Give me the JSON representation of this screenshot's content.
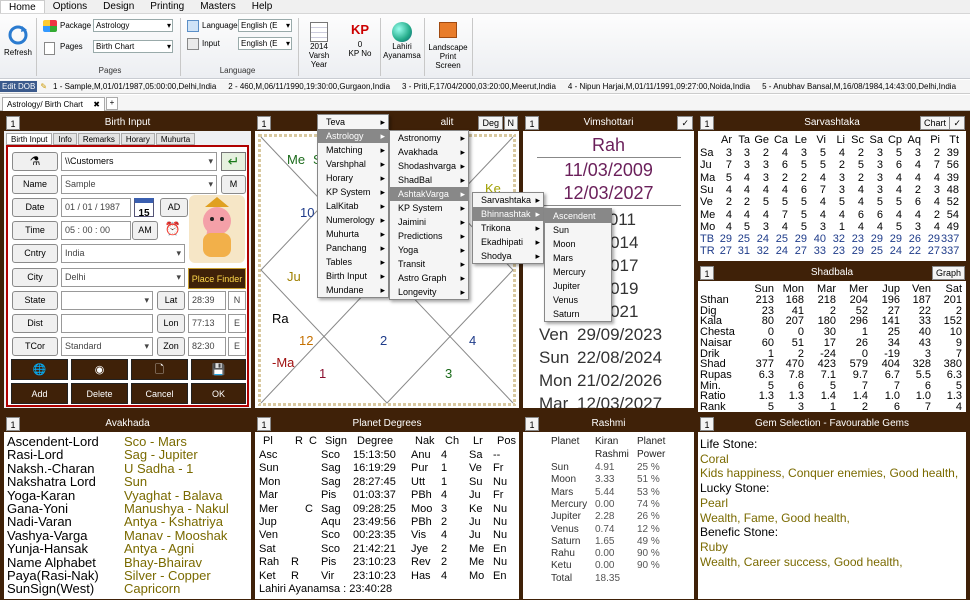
{
  "menubar": [
    "Home",
    "Options",
    "Design",
    "Printing",
    "Masters",
    "Help"
  ],
  "ribbon": {
    "refresh": "Refresh",
    "package_label": "Package",
    "package_value": "Astrology",
    "pages_label": "Pages",
    "pages_value": "Birth Chart",
    "group_pages": "Pages",
    "language_label": "Language",
    "language_value": "English (E",
    "input_label": "Input",
    "input_value": "English (E",
    "group_language": "Language",
    "varsh_year": "2014",
    "varsh_label": "Varsh Year",
    "kp_no": "0",
    "kp_label": "KP No",
    "lahiri": "Lahiri",
    "ayanamsa": "Ayanamsa",
    "landscape": "Landscape",
    "print_screen": "Print Screen"
  },
  "dobbar": {
    "edit": "Edit DOB",
    "items": [
      "1 - Sample,M,01/01/1987,05:00:00,Delhi,India",
      "2 - 460,M,06/11/1990,19:30:00,Gurgaon,India",
      "3 - Priti,F,17/04/2000,03:20:00,Meerut,India",
      "4 - Nipun Harjai,M,01/11/1991,09:27:00,Noida,India",
      "5 - Anubhav Bansal,M,16/08/1984,14:43:00,Delhi,India"
    ]
  },
  "tab": {
    "label": "Astrology/ Birth Chart",
    "plus": "+"
  },
  "birth": {
    "num": "1",
    "title": "Birth Input",
    "tabs": [
      "Birth Input",
      "Info",
      "Remarks",
      "Horary",
      "Muhurta"
    ],
    "path": "\\\\Customers",
    "name_l": "Name",
    "name_v": "Sample",
    "m": "M",
    "date_l": "Date",
    "date_v": "01 / 01 /  1987",
    "cal": "15",
    "ad": "AD",
    "time_l": "Time",
    "time_v": "05  :  00  :  00",
    "am": "AM",
    "cntry_l": "Cntry",
    "cntry_v": "India",
    "city_l": "City",
    "city_v": "Delhi",
    "place_finder": "Place Finder",
    "state_l": "State",
    "lat_l": "Lat",
    "lat_v": "28:39",
    "lat_d": "N",
    "dist_l": "Dist",
    "lon_l": "Lon",
    "lon_v": "77:13",
    "lon_d": "E",
    "tcor_l": "TCor",
    "tcor_v": "Standard",
    "zon_l": "Zon",
    "zon_v": "82:30",
    "zon_d": "E",
    "b_add": "Add",
    "b_delete": "Delete",
    "b_cancel": "Cancel",
    "b_ok": "OK"
  },
  "lagna": {
    "num": "1",
    "title_tail": "alit",
    "deg": "Deg",
    "n": "N",
    "me": "Me",
    "su_top": "Su",
    "ke": "Ke",
    "h10": "10",
    "ju": "Ju",
    "ra": "Ra",
    "h12": "12",
    "h2": "2",
    "h4": "4",
    "ma": "-Ma",
    "h1": "1",
    "h3": "3"
  },
  "menu1": [
    "Teva",
    "Astrology",
    "Matching",
    "Varshphal",
    "Horary",
    "KP System",
    "LalKitab",
    "Numerology",
    "Muhurta",
    "Panchang",
    "Tables",
    "Birth Input",
    "Mundane"
  ],
  "menu2": [
    "Astronomy",
    "Avakhada",
    "Shodashvarga",
    "ShadBal",
    "AshtakVarga",
    "KP System",
    "Jaimini",
    "Predictions",
    "Yoga",
    "Transit",
    "Astro Graph",
    "Longevity"
  ],
  "menu3": [
    "Sarvashtaka",
    "Bhinnashtak",
    "Trikona",
    "Ekadhipati",
    "Shodya"
  ],
  "menu4": [
    "Ascendent",
    "Sun",
    "Moon",
    "Mars",
    "Mercury",
    "Jupiter",
    "Venus",
    "Saturn"
  ],
  "vim": {
    "num": "1",
    "title": "Vimshottari",
    "planet": "Rah",
    "d1": "11/03/2009",
    "d2": "12/03/2027",
    "rows": [
      [
        "",
        "11/2011"
      ],
      [
        "",
        "04/2014"
      ],
      [
        "",
        "02/2017"
      ],
      [
        "",
        "09/2019"
      ],
      [
        "",
        "09/2021"
      ],
      [
        "Ven",
        "29/09/2023"
      ],
      [
        "Sun",
        "22/08/2024"
      ],
      [
        "Mon",
        "21/02/2026"
      ],
      [
        "Mar",
        "12/03/2027"
      ]
    ]
  },
  "sarva": {
    "num": "1",
    "title": "Sarvashtaka",
    "chart_btn": "Chart",
    "hdr": [
      "",
      "Ar",
      "Ta",
      "Ge",
      "Ca",
      "Le",
      "Vi",
      "Li",
      "Sc",
      "Sa",
      "Cp",
      "Aq",
      "Pi",
      "Tt"
    ],
    "rows": [
      [
        "Sa",
        "3",
        "3",
        "2",
        "4",
        "3",
        "5",
        "4",
        "2",
        "3",
        "5",
        "3",
        "2",
        "39"
      ],
      [
        "Ju",
        "7",
        "3",
        "3",
        "6",
        "5",
        "5",
        "2",
        "5",
        "3",
        "6",
        "4",
        "7",
        "56"
      ],
      [
        "Ma",
        "5",
        "4",
        "3",
        "2",
        "2",
        "4",
        "3",
        "2",
        "3",
        "4",
        "4",
        "4",
        "39"
      ],
      [
        "Su",
        "4",
        "4",
        "4",
        "4",
        "6",
        "7",
        "3",
        "4",
        "3",
        "4",
        "2",
        "3",
        "48"
      ],
      [
        "Ve",
        "2",
        "2",
        "5",
        "5",
        "5",
        "4",
        "5",
        "4",
        "5",
        "5",
        "6",
        "4",
        "52"
      ],
      [
        "Me",
        "4",
        "4",
        "4",
        "7",
        "5",
        "4",
        "4",
        "6",
        "6",
        "4",
        "4",
        "2",
        "54"
      ],
      [
        "Mo",
        "4",
        "5",
        "3",
        "4",
        "5",
        "3",
        "1",
        "4",
        "4",
        "5",
        "3",
        "4",
        "49"
      ],
      [
        "TB",
        "29",
        "25",
        "24",
        "25",
        "29",
        "40",
        "32",
        "23",
        "29",
        "29",
        "26",
        "29",
        "337"
      ],
      [
        "TR",
        "27",
        "31",
        "32",
        "24",
        "27",
        "33",
        "23",
        "29",
        "25",
        "24",
        "22",
        "27",
        "337"
      ]
    ]
  },
  "shad": {
    "num": "1",
    "title": "Shadbala",
    "graph_btn": "Graph",
    "hdr": [
      "",
      "Sun",
      "Mon",
      "Mar",
      "Mer",
      "Jup",
      "Ven",
      "Sat"
    ],
    "rows": [
      [
        "Sthan",
        "213",
        "168",
        "218",
        "204",
        "196",
        "187",
        "201"
      ],
      [
        "Dig",
        "23",
        "41",
        "2",
        "52",
        "27",
        "22",
        "2"
      ],
      [
        "Kala",
        "80",
        "207",
        "180",
        "296",
        "141",
        "33",
        "152"
      ],
      [
        "Chesta",
        "0",
        "0",
        "30",
        "1",
        "25",
        "40",
        "10"
      ],
      [
        "Naisar",
        "60",
        "51",
        "17",
        "26",
        "34",
        "43",
        "9"
      ],
      [
        "Drik",
        "1",
        "2",
        "-24",
        "0",
        "-19",
        "3",
        "7"
      ],
      [
        "Shad",
        "377",
        "470",
        "423",
        "579",
        "404",
        "328",
        "380"
      ],
      [
        "Rupas",
        "6.3",
        "7.8",
        "7.1",
        "9.7",
        "6.7",
        "5.5",
        "6.3"
      ],
      [
        "Min.",
        "5",
        "6",
        "5",
        "7",
        "7",
        "6",
        "5"
      ],
      [
        "Ratio",
        "1.3",
        "1.3",
        "1.4",
        "1.4",
        "1.0",
        "1.0",
        "1.3"
      ],
      [
        "Rank",
        "5",
        "3",
        "1",
        "2",
        "6",
        "7",
        "4"
      ]
    ]
  },
  "avak": {
    "num": "1",
    "title": "Avakhada",
    "rows": [
      [
        "Ascendent-Lord",
        "Sco - Mars"
      ],
      [
        "Rasi-Lord",
        "Sag - Jupiter"
      ],
      [
        "Naksh.-Charan",
        "U Sadha - 1"
      ],
      [
        "Nakshatra Lord",
        "Sun"
      ],
      [
        "Yoga-Karan",
        "Vyaghat - Balava"
      ],
      [
        "Gana-Yoni",
        "Manushya - Nakul"
      ],
      [
        "Nadi-Varan",
        "Antya - Kshatriya"
      ],
      [
        "Vashya-Varga",
        "Manav - Mooshak"
      ],
      [
        "Yunja-Hansak",
        "Antya - Agni"
      ],
      [
        "Name Alphabet",
        "Bhay-Bhairav"
      ],
      [
        "Paya(Rasi-Nak)",
        "Silver - Copper"
      ],
      [
        "SunSign(West)",
        "Capricorn"
      ]
    ]
  },
  "pdeg": {
    "num": "1",
    "title": "Planet Degrees",
    "hdr": [
      "Pl",
      "R",
      "C",
      "Sign",
      "Degree",
      "Nak",
      "Ch",
      "Lr",
      "Pos"
    ],
    "rows": [
      [
        "Asc",
        "",
        "",
        "Sco",
        "15:13:50",
        "Anu",
        "4",
        "Sa",
        "--"
      ],
      [
        "Sun",
        "",
        "",
        "Sag",
        "16:19:29",
        "Pur",
        "1",
        "Ve",
        "Fr"
      ],
      [
        "Mon",
        "",
        "",
        "Sag",
        "28:27:45",
        "Utt",
        "1",
        "Su",
        "Nu"
      ],
      [
        "Mar",
        "",
        "",
        "Pis",
        "01:03:37",
        "PBh",
        "4",
        "Ju",
        "Fr"
      ],
      [
        "Mer",
        "",
        "C",
        "Sag",
        "09:28:25",
        "Moo",
        "3",
        "Ke",
        "Nu"
      ],
      [
        "Jup",
        "",
        "",
        "Aqu",
        "23:49:56",
        "PBh",
        "2",
        "Ju",
        "Nu"
      ],
      [
        "Ven",
        "",
        "",
        "Sco",
        "00:23:35",
        "Vis",
        "4",
        "Ju",
        "Nu"
      ],
      [
        "Sat",
        "",
        "",
        "Sco",
        "21:42:21",
        "Jye",
        "2",
        "Me",
        "En"
      ],
      [
        "Rah",
        "R",
        "",
        "Pis",
        "23:10:23",
        "Rev",
        "2",
        "Me",
        "Nu"
      ],
      [
        "Ket",
        "R",
        "",
        "Vir",
        "23:10:23",
        "Has",
        "4",
        "Mo",
        "En"
      ]
    ],
    "footer": "Lahiri Ayanamsa : 23:40:28"
  },
  "rashmi": {
    "num": "1",
    "title": "Rashmi",
    "h1": "Planet",
    "h2a": "Kiran",
    "h2b": "Rashmi",
    "h3a": "Planet",
    "h3b": "Power",
    "rows": [
      [
        "Sun",
        "4.91",
        "25 %"
      ],
      [
        "Moon",
        "3.33",
        "51 %"
      ],
      [
        "Mars",
        "5.44",
        "53 %"
      ],
      [
        "Mercury",
        "0.00",
        "74 %"
      ],
      [
        "Jupiter",
        "2.28",
        "26 %"
      ],
      [
        "Venus",
        "0.74",
        "12 %"
      ],
      [
        "Saturn",
        "1.65",
        "49 %"
      ],
      [
        "Rahu",
        "0.00",
        "90 %"
      ],
      [
        "Ketu",
        "0.00",
        "90 %"
      ],
      [
        "Total",
        "18.35",
        ""
      ]
    ]
  },
  "gem": {
    "num": "1",
    "title": "Gem Selection - Favourable Gems",
    "lines": [
      "Life Stone:",
      "Coral",
      "Kids happiness, Conquer enemies, Good health,",
      "Lucky Stone:",
      "Pearl",
      "Wealth, Fame, Good health,",
      "Benefic Stone:",
      "Ruby",
      "Wealth, Career success, Good health,"
    ]
  },
  "colors": {
    "brown": "#3f2108",
    "purple": "#6a1f5a",
    "blue": "#1f3c8a",
    "olive": "#7a6a00",
    "green": "#1a6a1a",
    "red": "#a01010"
  }
}
